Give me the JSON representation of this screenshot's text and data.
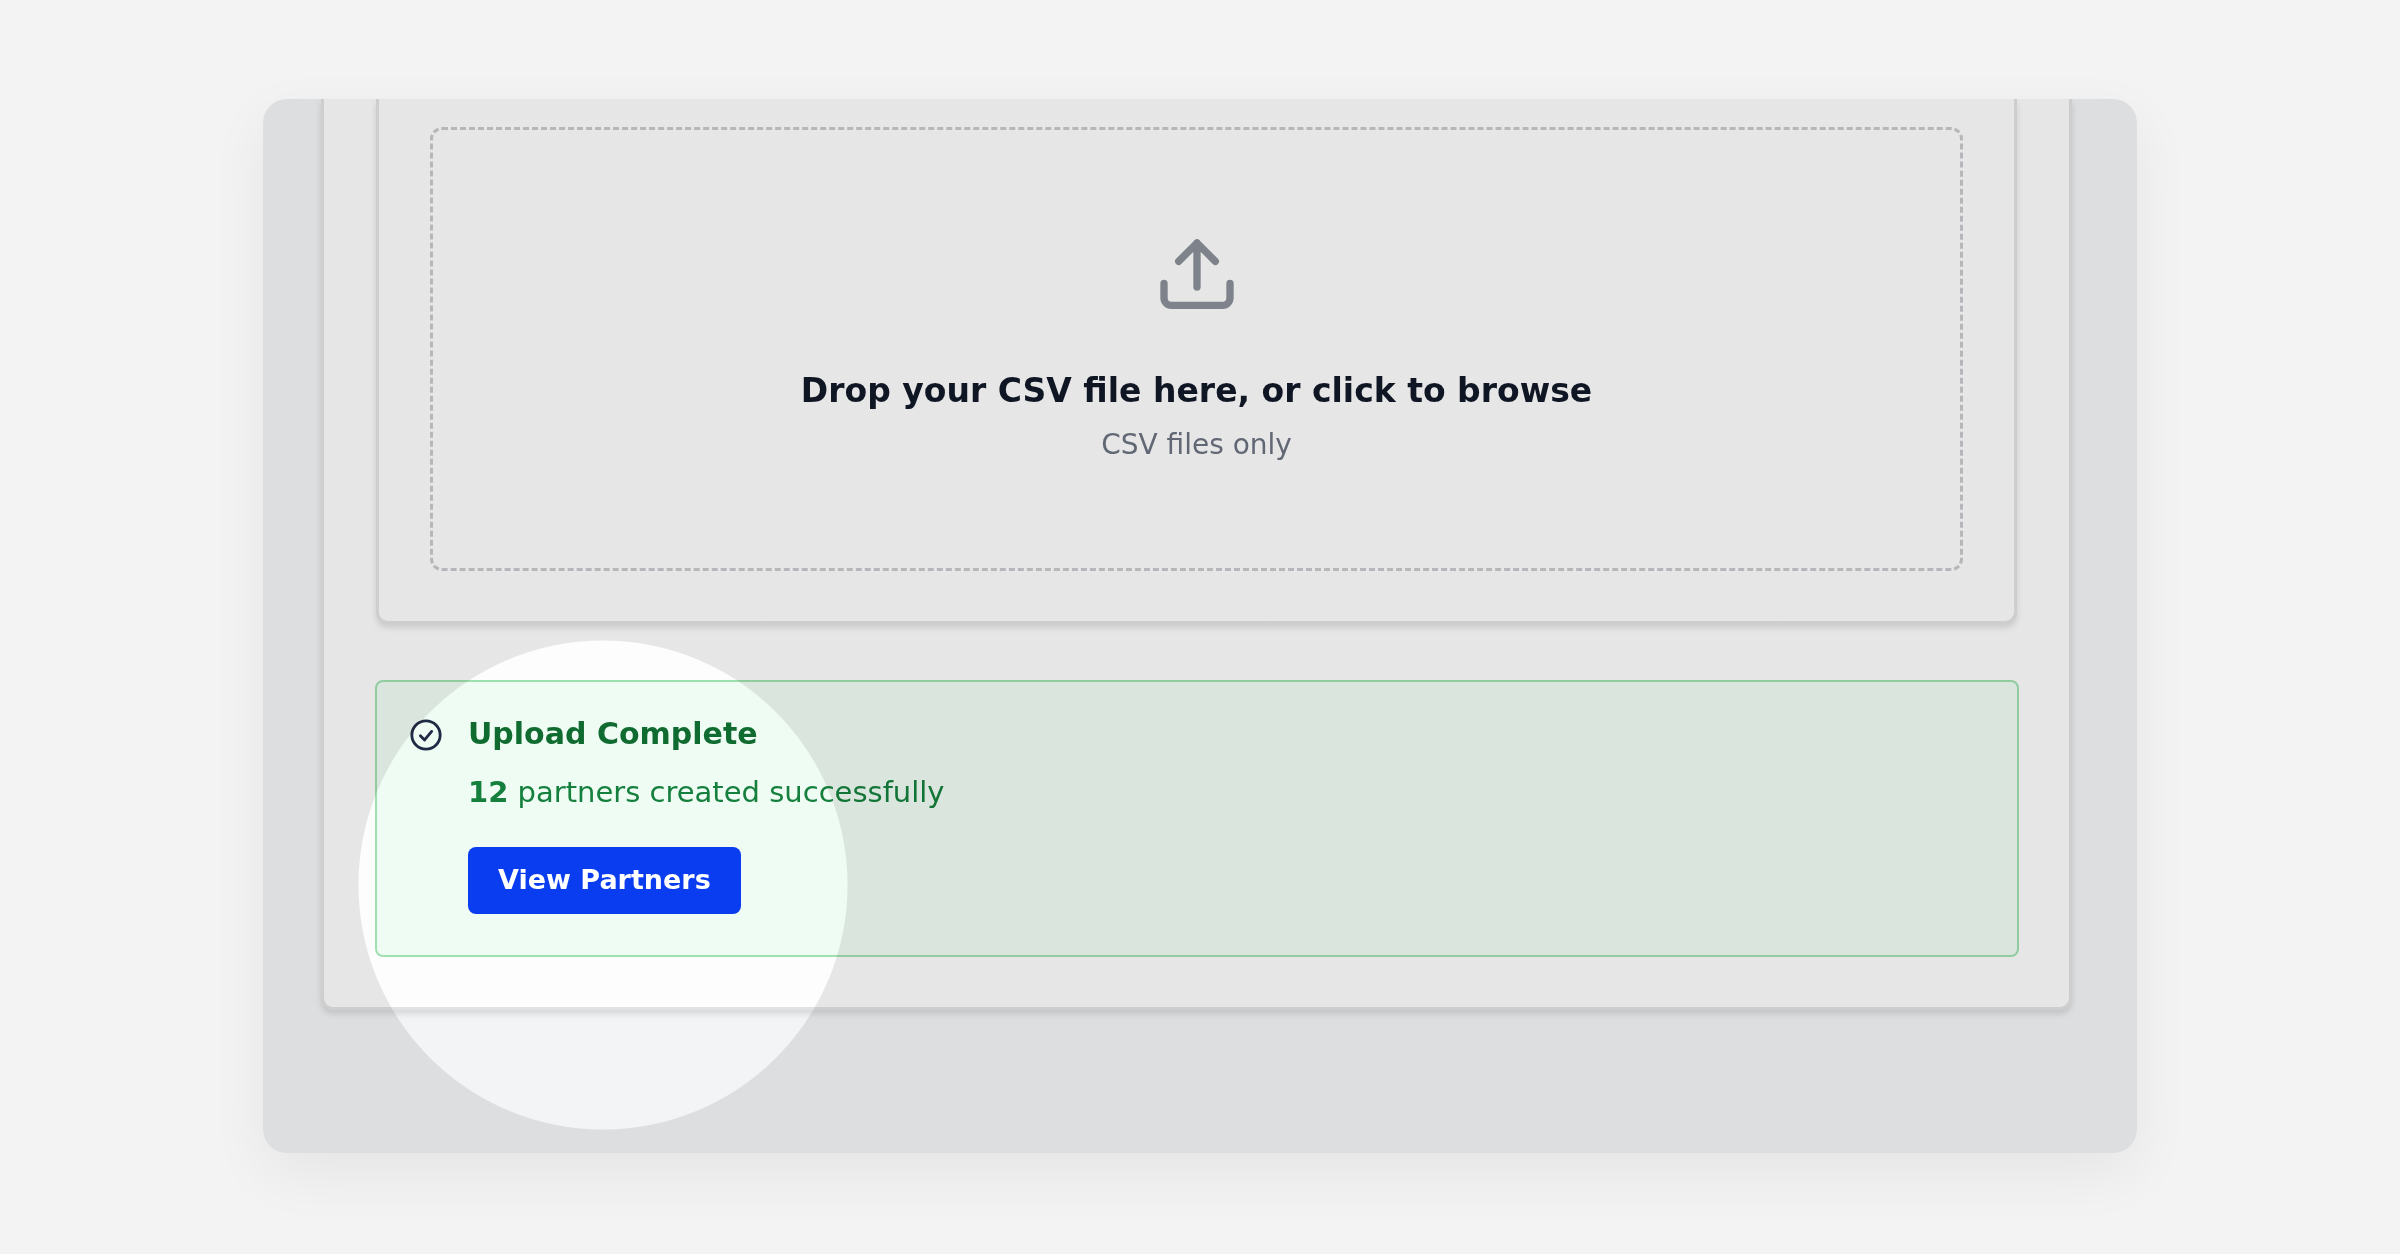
{
  "dropzone": {
    "title": "Drop your CSV file here, or click to browse",
    "hint": "CSV files only"
  },
  "alert": {
    "title": "Upload Complete",
    "message": "**12** partners created successfully",
    "button": "View Partners"
  }
}
